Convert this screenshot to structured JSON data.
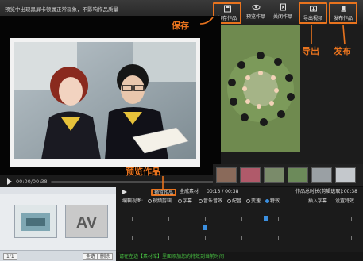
{
  "topbar": {
    "notice": "预览中出现黑屏卡顿属正常现象，不影响作品质量",
    "buttons": {
      "save": "保存作品",
      "preview": "预览作品",
      "close": "关闭作品",
      "export": "导出视频",
      "publish": "发布作品"
    }
  },
  "annotations": {
    "save": "保存",
    "export": "导出",
    "publish": "发布",
    "preview": "预览作品"
  },
  "player": {
    "time": "00:00/00:38"
  },
  "library": {
    "page": "1/1",
    "select_all": "全选",
    "delete": "删除"
  },
  "timeline": {
    "preview_btn": "预览作品",
    "full_material": "全成素材",
    "position": "00:13 / 00:38",
    "total_label": "作品总时长(剪辑选取):00:38",
    "edit_view_label": "编辑视图:",
    "options": [
      "视频剪辑",
      "字幕",
      "音乐音效",
      "配音",
      "变速",
      "特效"
    ],
    "insert_clip": "插入字幕",
    "set_effect": "设置特效",
    "status": "请在左边【素材库】里面添加您的特效到当前时间"
  },
  "colors": {
    "highlight": "#e8731e",
    "status_green": "#49c443",
    "accent_blue": "#3b8fe0"
  }
}
